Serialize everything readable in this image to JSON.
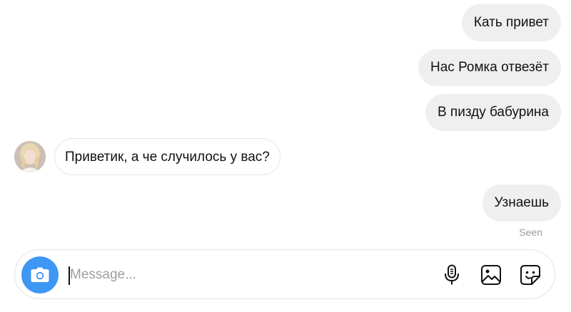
{
  "messages": [
    {
      "direction": "outgoing",
      "text": "Кать привет"
    },
    {
      "direction": "outgoing",
      "text": "Нас Ромка отвезёт"
    },
    {
      "direction": "outgoing",
      "text": "В пизду бабурина"
    },
    {
      "direction": "incoming",
      "text": "Приветик, а че случилось у вас?"
    },
    {
      "direction": "outgoing",
      "text": "Узнаешь"
    }
  ],
  "status": {
    "seen_label": "Seen"
  },
  "composer": {
    "placeholder": "Message...",
    "value": ""
  },
  "icons": {
    "camera": "camera-icon",
    "microphone": "microphone-icon",
    "gallery": "image-icon",
    "sticker": "sticker-icon"
  },
  "colors": {
    "accent": "#3e97f5",
    "outgoing_bubble": "#efefef",
    "incoming_border": "#e6e6e6",
    "seen_text": "#9a9a9a"
  }
}
